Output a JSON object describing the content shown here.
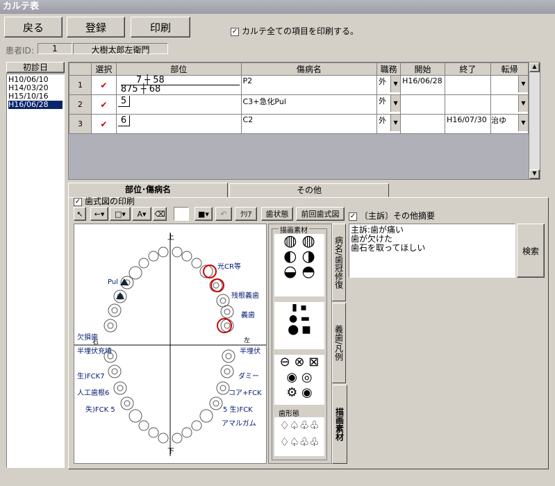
{
  "window": {
    "title": "カルテ表"
  },
  "toolbar": {
    "back": "戻る",
    "register": "登録",
    "print": "印刷"
  },
  "print_all": {
    "label": "カルテ全ての項目を印刷する。",
    "checked": "✓"
  },
  "patient": {
    "id_label": "患者ID:",
    "id": "1",
    "name": "大樹太郎左衛門"
  },
  "first_visit": {
    "header": "初診日",
    "dates": [
      "H10/06/10",
      "H14/03/20",
      "H15/10/16",
      "H16/06/28"
    ]
  },
  "grid": {
    "headers": [
      "選択",
      "部位",
      "傷病名",
      "職務",
      "開始",
      "終了",
      "転帰"
    ],
    "rows": [
      {
        "no": "1",
        "site_upper": "7 ┼ 58",
        "site_lower": "875 ┼ 68",
        "disease": "P2",
        "job": "外",
        "start": "H16/06/28",
        "end": "",
        "outcome": ""
      },
      {
        "no": "2",
        "site_upper": "5",
        "site_lower": "",
        "disease": "C3+急化Pul",
        "job": "外",
        "start": "",
        "end": "",
        "outcome": ""
      },
      {
        "no": "3",
        "site_upper": "6",
        "site_lower": "",
        "disease": "C2",
        "job": "外",
        "start": "",
        "end": "H16/07/30",
        "outcome": "治ゆ"
      }
    ]
  },
  "tabs": {
    "active": "部位･傷病名",
    "other": "その他"
  },
  "chart_print": {
    "label": "歯式図の印刷",
    "checked": "✓"
  },
  "drawing_tools": {
    "clear": "ｸﾘｱ",
    "tooth_state": "歯状態",
    "prev_chart": "前回歯式図",
    "complaint_label": "〔主訴〕その他摘要",
    "complaint_checked": "✓"
  },
  "material_panel": {
    "title": "描画素材",
    "shape_title": "歯形態"
  },
  "vertical_tabs": [
    "病名/歯冠修復",
    "義歯/凡例",
    "描画素材"
  ],
  "complaint": {
    "lines": [
      "主訴:歯が痛い",
      "歯が欠けた",
      "歯石を取ってほしい"
    ]
  },
  "search": "検索",
  "chart_labels": {
    "upper": "上",
    "lower": "下",
    "right": "右",
    "left": "左",
    "crown": "光CR等",
    "root_denture": "残根義歯",
    "denture": "義歯",
    "pul": "Pul",
    "missing": "欠損歯",
    "half_buried_r": "半埋伏充填",
    "half_buried_l": "半埋伏",
    "fck_r7": "生)FCK7",
    "dummy": "ダミー",
    "artificial": "人工歯根6",
    "core_fck": "コア+FCK",
    "fck5": "失)FCK 5",
    "fck_l5": "5 生)FCK",
    "amalgam": "アマルガム"
  }
}
